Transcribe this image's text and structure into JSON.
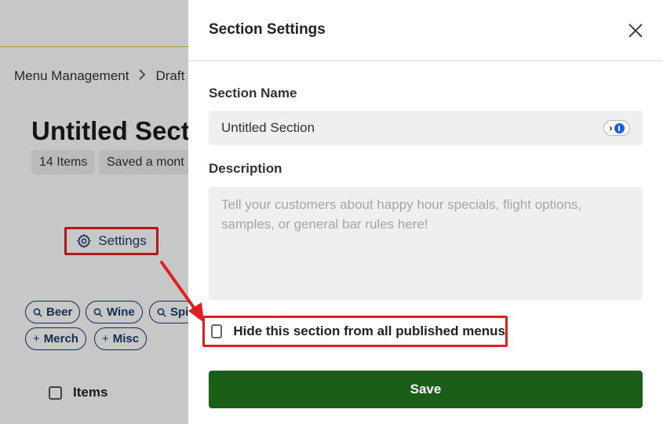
{
  "background": {
    "breadcrumb": {
      "item1": "Menu Management",
      "item2": "Draft"
    },
    "section_title": "Untitled Sect",
    "chips": {
      "count": "14 Items",
      "saved": "Saved a mont"
    },
    "settings_button": {
      "label": "Settings",
      "icon": "gear-icon"
    },
    "filter_pills": [
      {
        "label": "Beer",
        "icon": "search-icon"
      },
      {
        "label": "Wine",
        "icon": "search-icon"
      },
      {
        "label": "Spi",
        "icon": "search-icon"
      },
      {
        "label": "Merch",
        "icon": "plus-icon"
      },
      {
        "label": "Misc",
        "icon": "plus-icon"
      }
    ],
    "items_header": "Items"
  },
  "modal": {
    "title": "Section Settings",
    "close_icon": "close-icon",
    "section_name": {
      "label": "Section Name",
      "value": "Untitled Section",
      "badge_icon": "password-manager-icon"
    },
    "description": {
      "label": "Description",
      "value": "",
      "placeholder": "Tell your customers about happy hour specials, flight options, samples, or general bar rules here!"
    },
    "hide_section": {
      "label": "Hide this section from all published menus",
      "checked": false
    },
    "save_label": "Save"
  },
  "colors": {
    "save_button": "#1b5e17",
    "highlight": "#e02020",
    "brand_navy": "#1b3a6b",
    "top_border": "#e2c26a"
  }
}
